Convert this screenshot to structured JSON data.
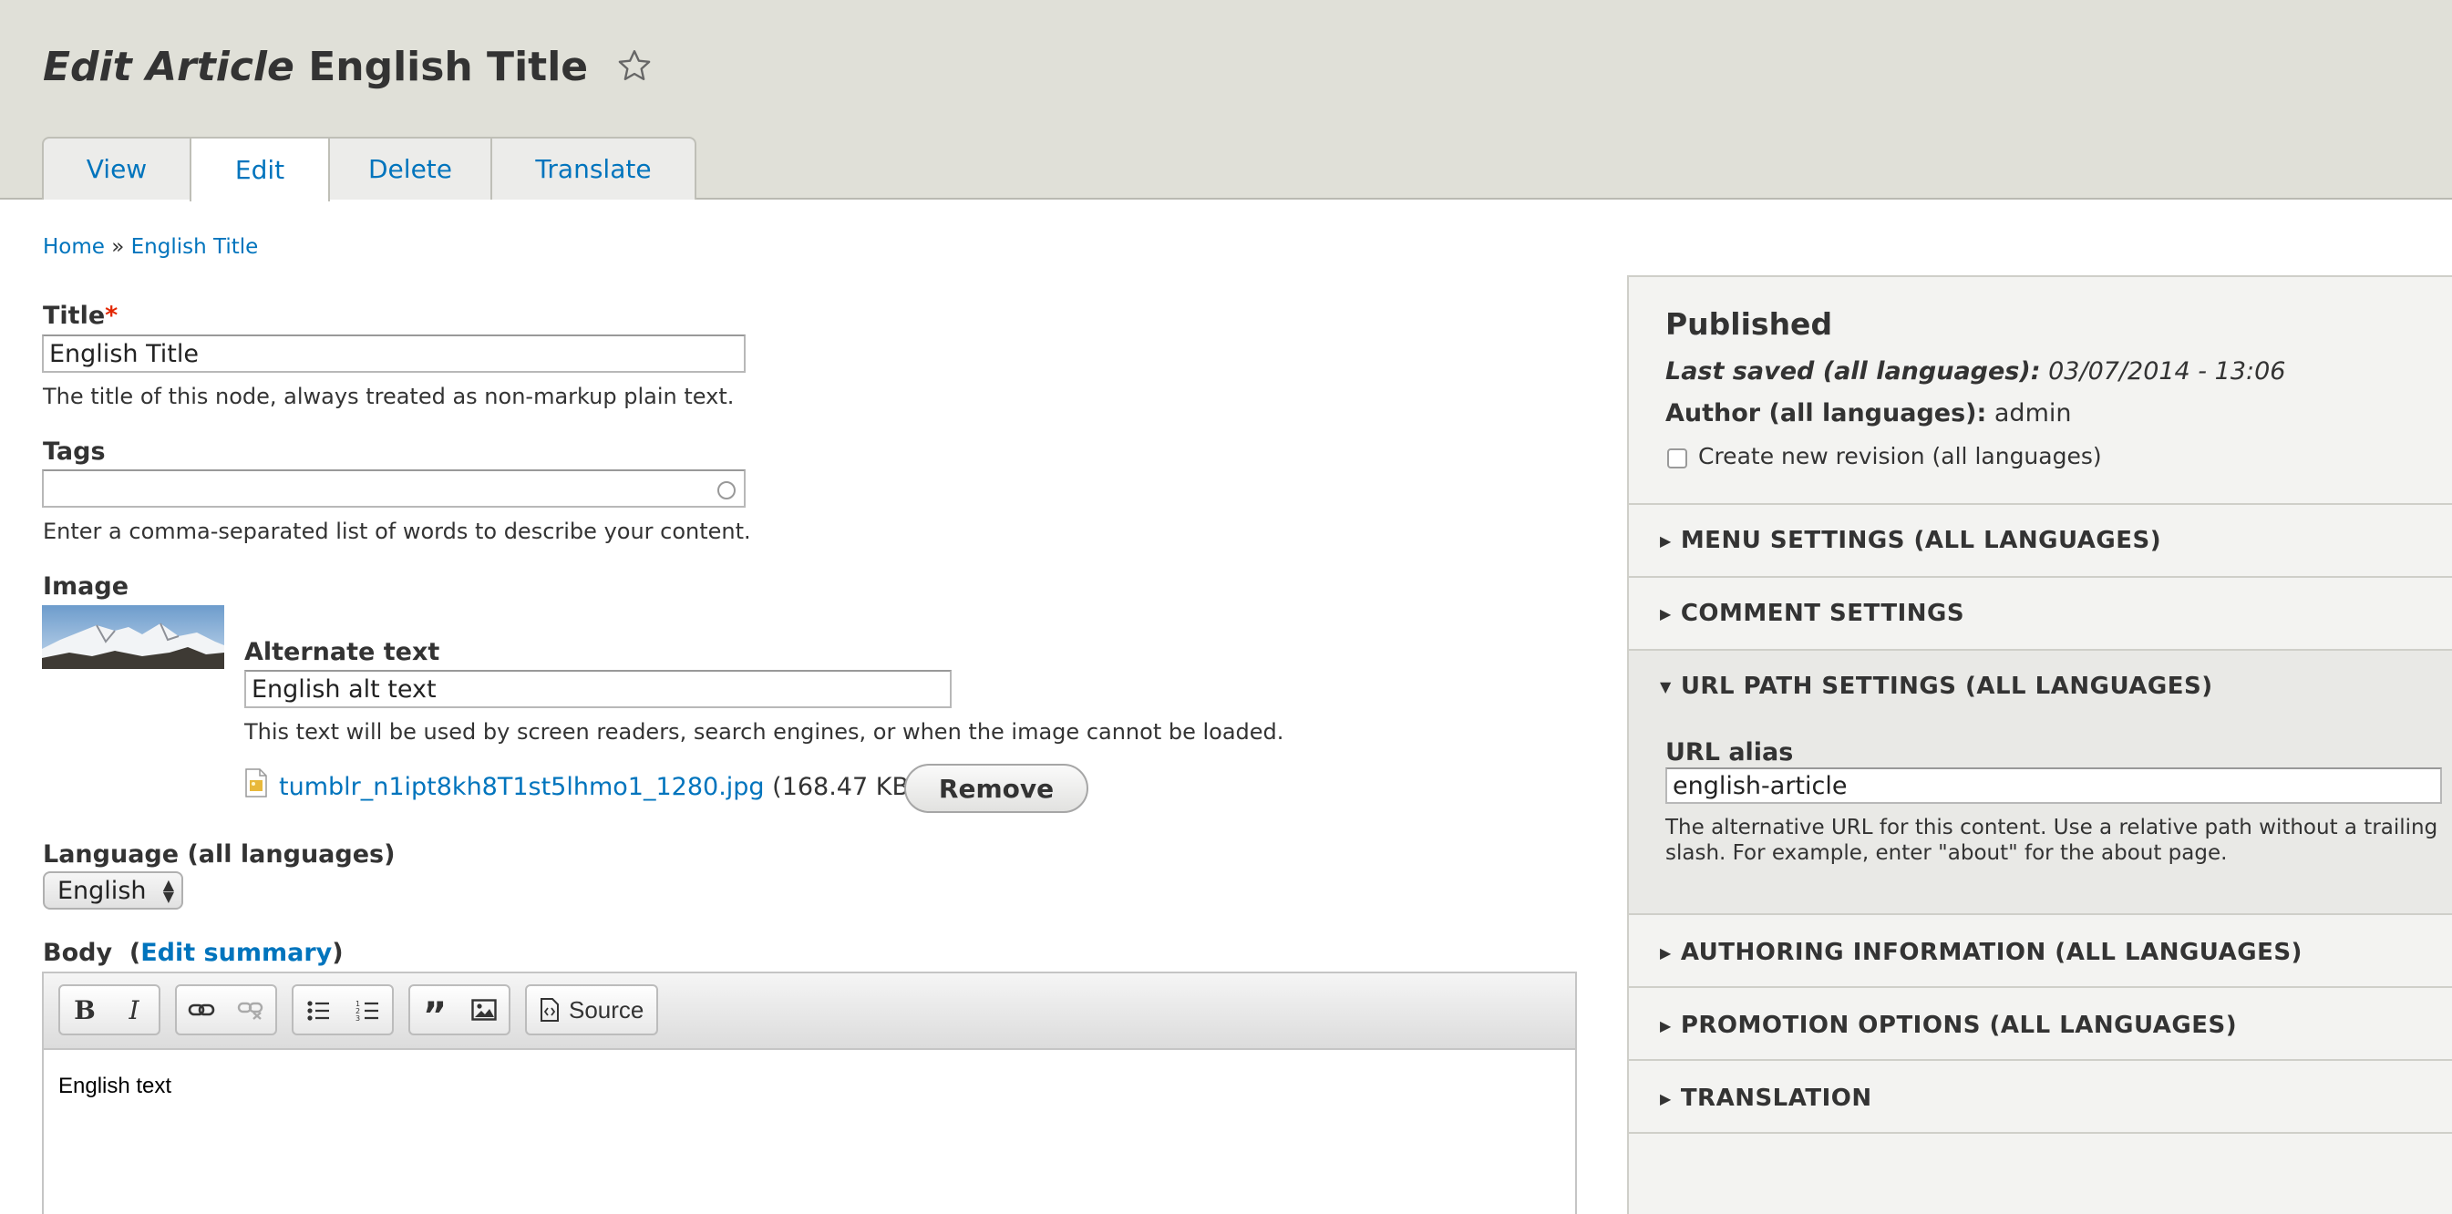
{
  "header": {
    "title_italic": "Edit Article",
    "title_rest": "English Title",
    "tabs": [
      {
        "label": "View"
      },
      {
        "label": "Edit"
      },
      {
        "label": "Delete"
      },
      {
        "label": "Translate"
      }
    ],
    "active_tab": "Edit",
    "star_icon": "star-outline-icon"
  },
  "breadcrumb": {
    "home": "Home",
    "separator": "»",
    "current": "English Title"
  },
  "form": {
    "title": {
      "label": "Title",
      "required_marker": "*",
      "value": "English Title",
      "description": "The title of this node, always treated as non-markup plain text."
    },
    "tags": {
      "label": "Tags",
      "value": "",
      "description": "Enter a comma-separated list of words to describe your content."
    },
    "image": {
      "label": "Image",
      "alt_label": "Alternate text",
      "alt_value": "English alt text",
      "alt_description": "This text will be used by screen readers, search engines, or when the image cannot be loaded.",
      "file_name": "tumblr_n1ipt8kh8T1st5lhmo1_1280.jpg",
      "file_size": "(168.47 KB)",
      "remove_label": "Remove"
    },
    "language": {
      "label": "Language (all languages)",
      "selected": "English"
    },
    "body": {
      "label": "Body",
      "open_paren": "(",
      "edit_summary": "Edit summary",
      "close_paren": ")",
      "source_label": "Source",
      "content": "English text"
    }
  },
  "sidebar": {
    "status": "Published",
    "last_saved_label": "Last saved (all languages):",
    "last_saved_value": "03/07/2014 - 13:06",
    "author_label": "Author (all languages):",
    "author_value": "admin",
    "revision_label": "Create new revision (all languages)",
    "revision_checked": false,
    "sections": [
      {
        "label": "MENU SETTINGS (ALL LANGUAGES)",
        "open": false
      },
      {
        "label": "COMMENT SETTINGS",
        "open": false
      },
      {
        "label": "URL PATH SETTINGS (ALL LANGUAGES)",
        "open": true
      },
      {
        "label": "AUTHORING INFORMATION (ALL LANGUAGES)",
        "open": false
      },
      {
        "label": "PROMOTION OPTIONS (ALL LANGUAGES)",
        "open": false
      },
      {
        "label": "TRANSLATION",
        "open": false
      }
    ],
    "url_alias": {
      "label": "URL alias",
      "value": "english-article",
      "description": "The alternative URL for this content. Use a relative path without a trailing slash. For example, enter \"about\" for the about page."
    }
  },
  "colors": {
    "link": "#0074bd",
    "header_bg": "#e0e0d8",
    "sidebar_bg": "#f3f3f1",
    "required": "#e32700"
  }
}
